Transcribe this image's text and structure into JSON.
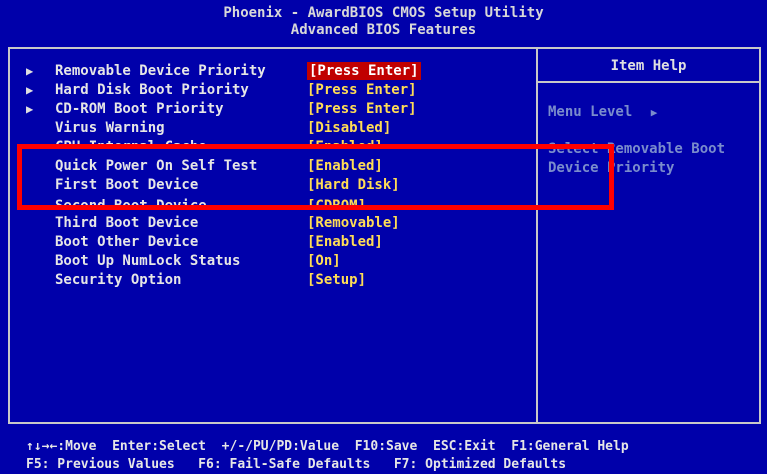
{
  "header": {
    "title": "Phoenix - AwardBIOS CMOS Setup Utility",
    "subtitle": "Advanced BIOS Features"
  },
  "help": {
    "title": "Item Help",
    "menu_level": "Menu Level",
    "menu_level_arrow": "▶",
    "line1": "Select Removable Boot",
    "line2": "Device Priority"
  },
  "rows": [
    {
      "arrow": "▶",
      "label": "Removable Device Priority",
      "value": "[Press Enter]"
    },
    {
      "arrow": "▶",
      "label": "Hard Disk Boot Priority",
      "value": "[Press Enter]"
    },
    {
      "arrow": "▶",
      "label": "CD-ROM Boot Priority",
      "value": "[Press Enter]"
    },
    {
      "arrow": "",
      "label": "Virus Warning",
      "value": "[Disabled]"
    },
    {
      "arrow": "",
      "label": "CPU Internal Cache",
      "value": "[Enabled]"
    },
    {
      "arrow": "",
      "label": "Quick Power On Self Test",
      "value": "[Enabled]"
    },
    {
      "arrow": "",
      "label": "First Boot Device",
      "value": "[Hard Disk]"
    },
    {
      "arrow": "",
      "label": "Second Boot Device",
      "value": "[CDROM]"
    },
    {
      "arrow": "",
      "label": "Third Boot Device",
      "value": "[Removable]"
    },
    {
      "arrow": "",
      "label": "Boot Other Device",
      "value": "[Enabled]"
    },
    {
      "arrow": "",
      "label": "Boot Up NumLock Status",
      "value": "[On]"
    },
    {
      "arrow": "",
      "label": "Security Option",
      "value": "[Setup]"
    }
  ],
  "footer": {
    "line1": "↑↓→←:Move  Enter:Select  +/-/PU/PD:Value  F10:Save  ESC:Exit  F1:General Help",
    "line2": "F5: Previous Values   F6: Fail-Safe Defaults   F7: Optimized Defaults"
  },
  "colors": {
    "background": "#0000aa",
    "value_text": "#ffdd55",
    "selected_value_bg": "#c00000",
    "annotation_box": "#ff0000"
  }
}
